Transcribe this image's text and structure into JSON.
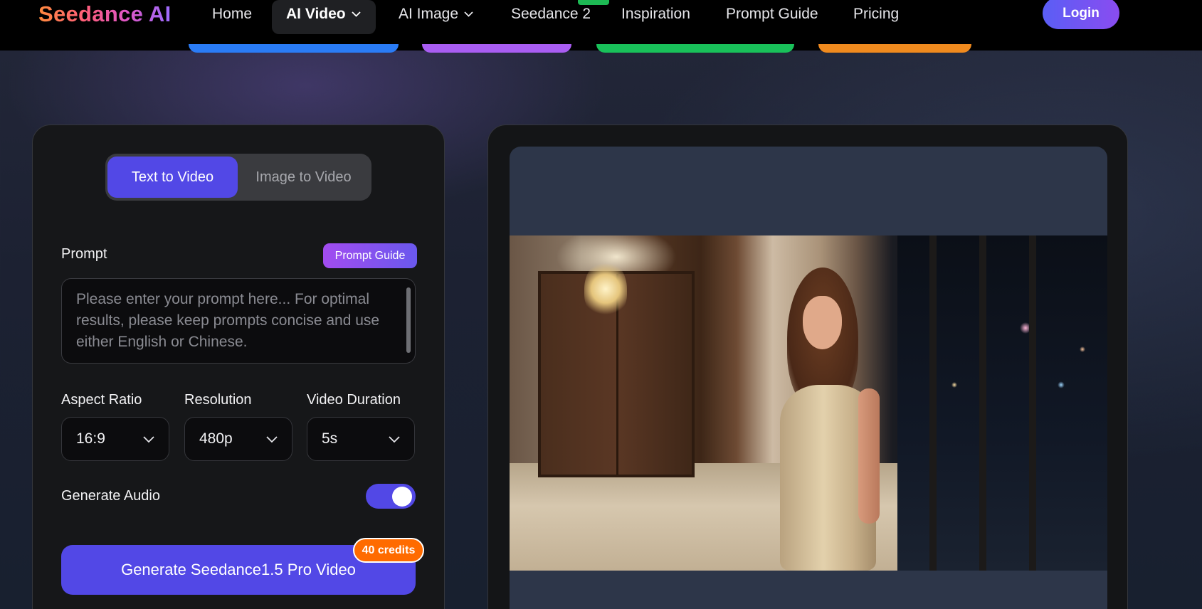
{
  "nav": {
    "logo": "Seedance AI",
    "items": [
      {
        "label": "Home"
      },
      {
        "label": "AI Video"
      },
      {
        "label": "AI Image"
      },
      {
        "label": "Seedance 2"
      },
      {
        "label": "Inspiration"
      },
      {
        "label": "Prompt Guide"
      },
      {
        "label": "Pricing"
      }
    ],
    "login_label": "Login"
  },
  "generator": {
    "mode_tabs": [
      {
        "label": "Text to Video",
        "selected": true
      },
      {
        "label": "Image to Video",
        "selected": false
      }
    ],
    "prompt_label": "Prompt",
    "prompt_guide_label": "Prompt Guide",
    "prompt_value": "",
    "prompt_placeholder": "Please enter your prompt here... For optimal results, please keep prompts concise and use either English or Chinese.",
    "aspect_ratio": {
      "label": "Aspect Ratio",
      "value": "16:9"
    },
    "resolution": {
      "label": "Resolution",
      "value": "480p"
    },
    "duration": {
      "label": "Video Duration",
      "value": "5s"
    },
    "audio": {
      "label": "Generate Audio",
      "enabled": true
    },
    "generate_label": "Generate Seedance1.5 Pro Video",
    "credits_badge": "40 credits"
  },
  "preview": {
    "icon": "video-preview"
  },
  "colors": {
    "accent": "#5248e6",
    "credits": "#ff6b00",
    "new_badge": "#1db954"
  }
}
